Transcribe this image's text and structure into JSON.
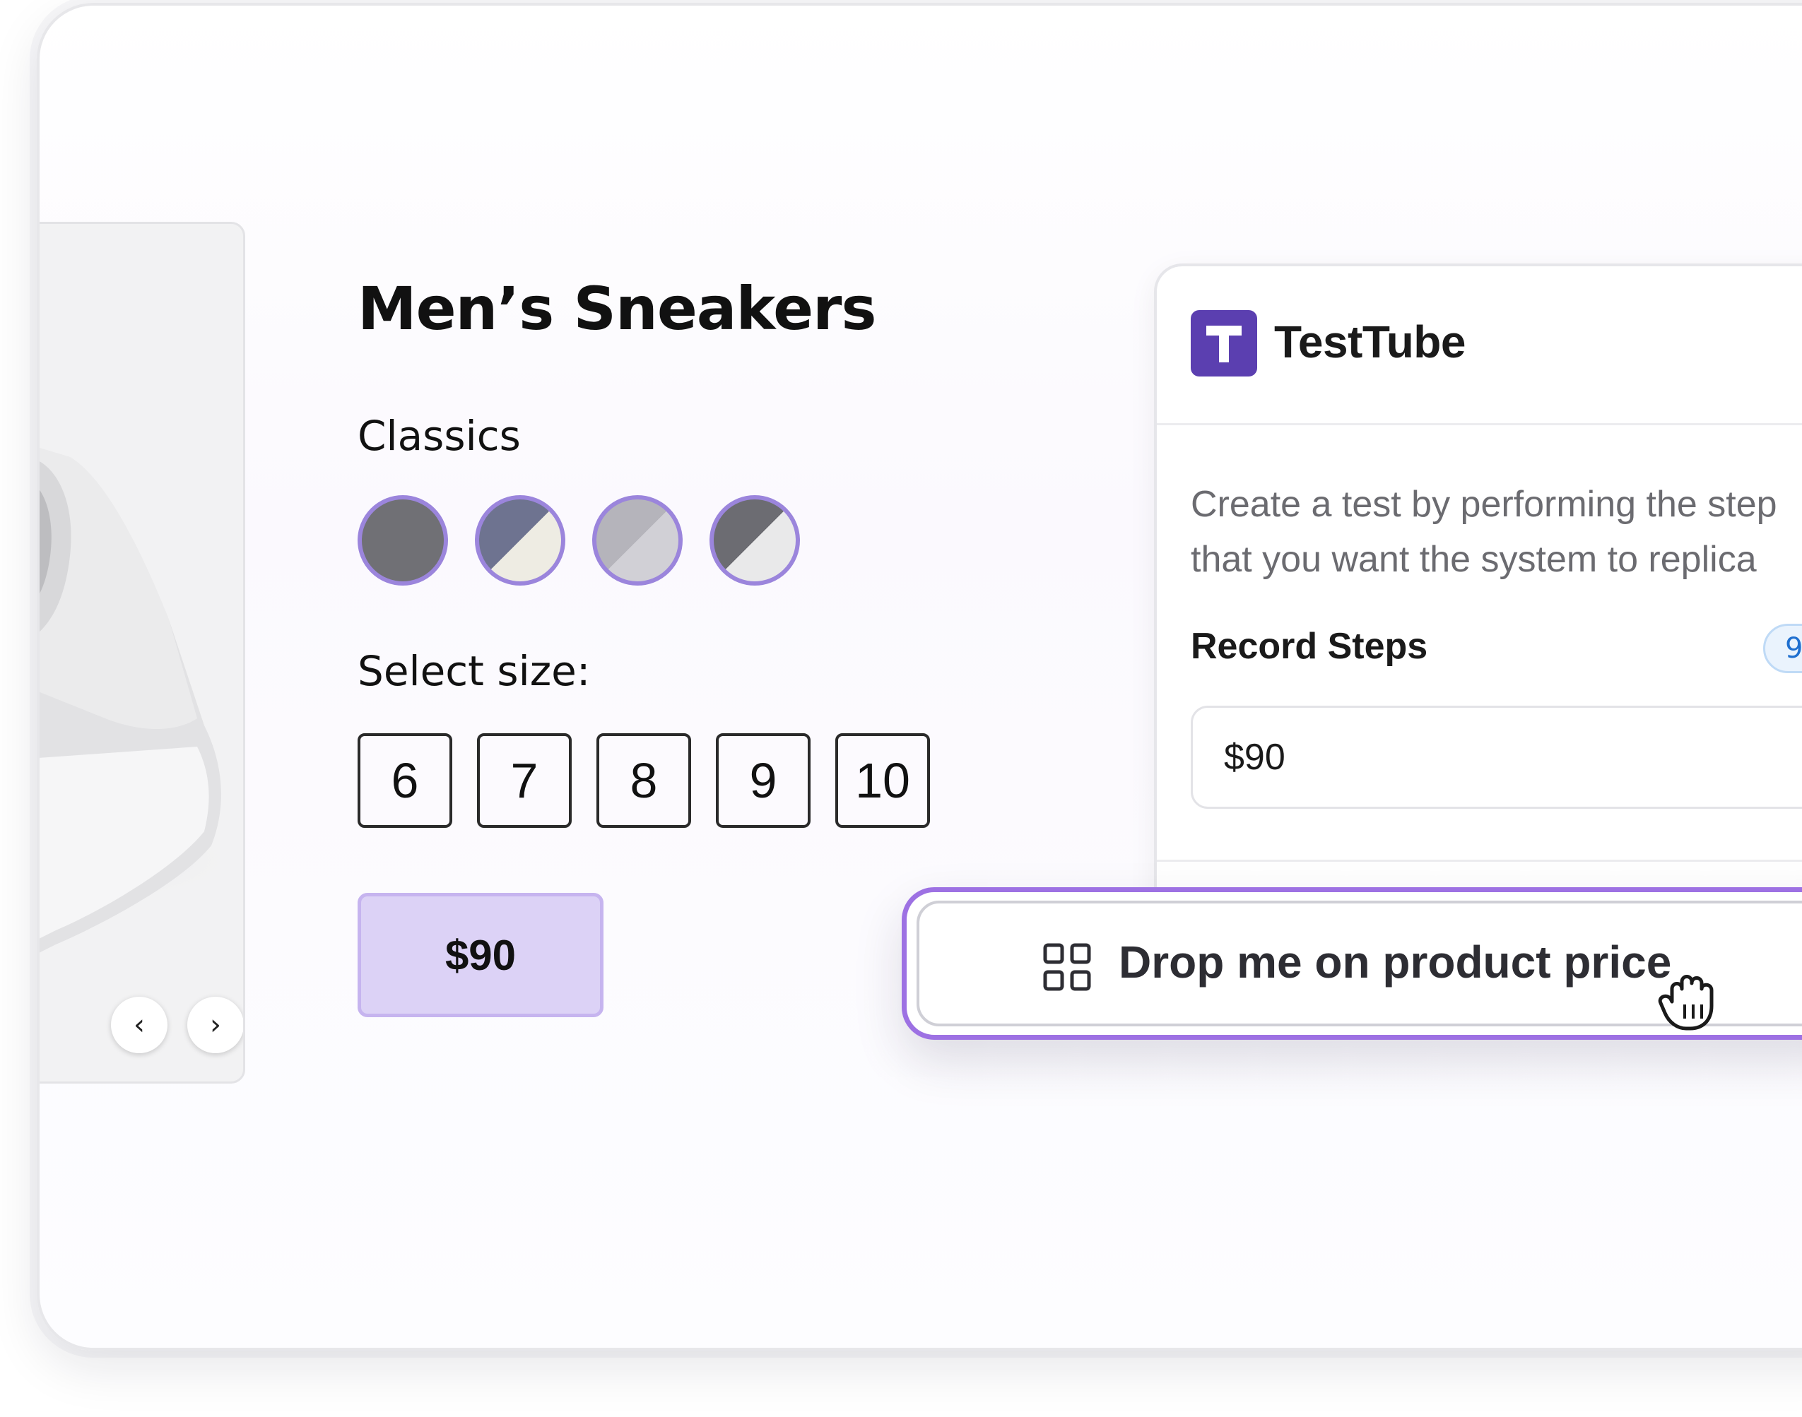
{
  "product": {
    "title": "Men’s Sneakers",
    "collection": "Classics",
    "size_label": "Select size:",
    "sizes": [
      "6",
      "7",
      "8",
      "9",
      "10"
    ],
    "price": "$90",
    "swatches": [
      {
        "name": "solid-dark-gray",
        "color_a": "#707075",
        "color_b": "#707075"
      },
      {
        "name": "slate-cream",
        "color_a": "#6e7390",
        "color_b": "#eeece3"
      },
      {
        "name": "light-gray",
        "color_a": "#b5b4bb",
        "color_b": "#d1d0d6"
      },
      {
        "name": "charcoal-white",
        "color_a": "#6c6c72",
        "color_b": "#e9e9ea"
      }
    ]
  },
  "image_nav": {
    "prev": "‹",
    "next": "›"
  },
  "panel": {
    "brand": "TestTube",
    "description_line1": "Create a test by performing the step",
    "description_line2": "that you want the system to replica",
    "record_steps_title": "Record Steps",
    "steps_count": "9",
    "step_value": "$90"
  },
  "drag_chip": {
    "label": "Drop me on product price"
  },
  "colors": {
    "accent_purple": "#9d71e3",
    "brand_purple": "#5b3fb0",
    "price_bg": "#dcd2f6",
    "badge_blue": "#1f6fcf"
  },
  "icons": {
    "chip_icon": "grid-icon",
    "cursor": "grab-hand-icon",
    "logo": "testtube-logo-icon"
  }
}
